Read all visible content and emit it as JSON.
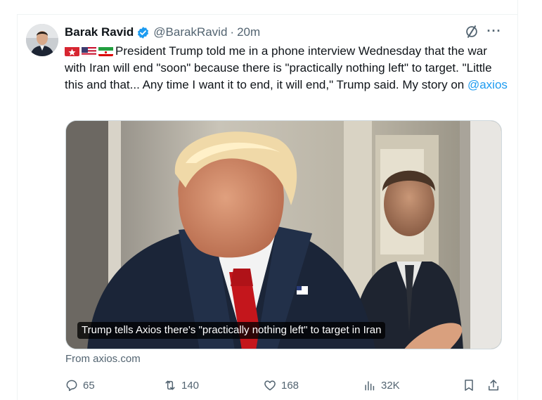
{
  "tweet": {
    "author_name": "Barak Ravid",
    "author_handle": "@BarakRavid",
    "separator": "·",
    "time_ago": "20m",
    "flags": [
      "israel-flag-icon",
      "us-flag-icon",
      "iran-flag-icon"
    ],
    "text_main": "President Trump told me in a phone interview Wednesday that the war with Iran will end \"soon\" because there is \"practically nothing left\" to target. \"Little this and that... Any time I want it to end, it will end,\" Trump said. My story on ",
    "mention": "@axios",
    "more_symbol": "···"
  },
  "media": {
    "caption": "Trump tells Axios there's \"practically nothing left\" to target in Iran",
    "source_text": "From axios.com"
  },
  "actions": {
    "replies": "65",
    "reposts": "140",
    "likes": "168",
    "views": "32K"
  },
  "colors": {
    "accent": "#1d9bf0",
    "secondary_text": "#536471",
    "primary_text": "#0f1419",
    "verified_badge": "#1d9bf0"
  }
}
